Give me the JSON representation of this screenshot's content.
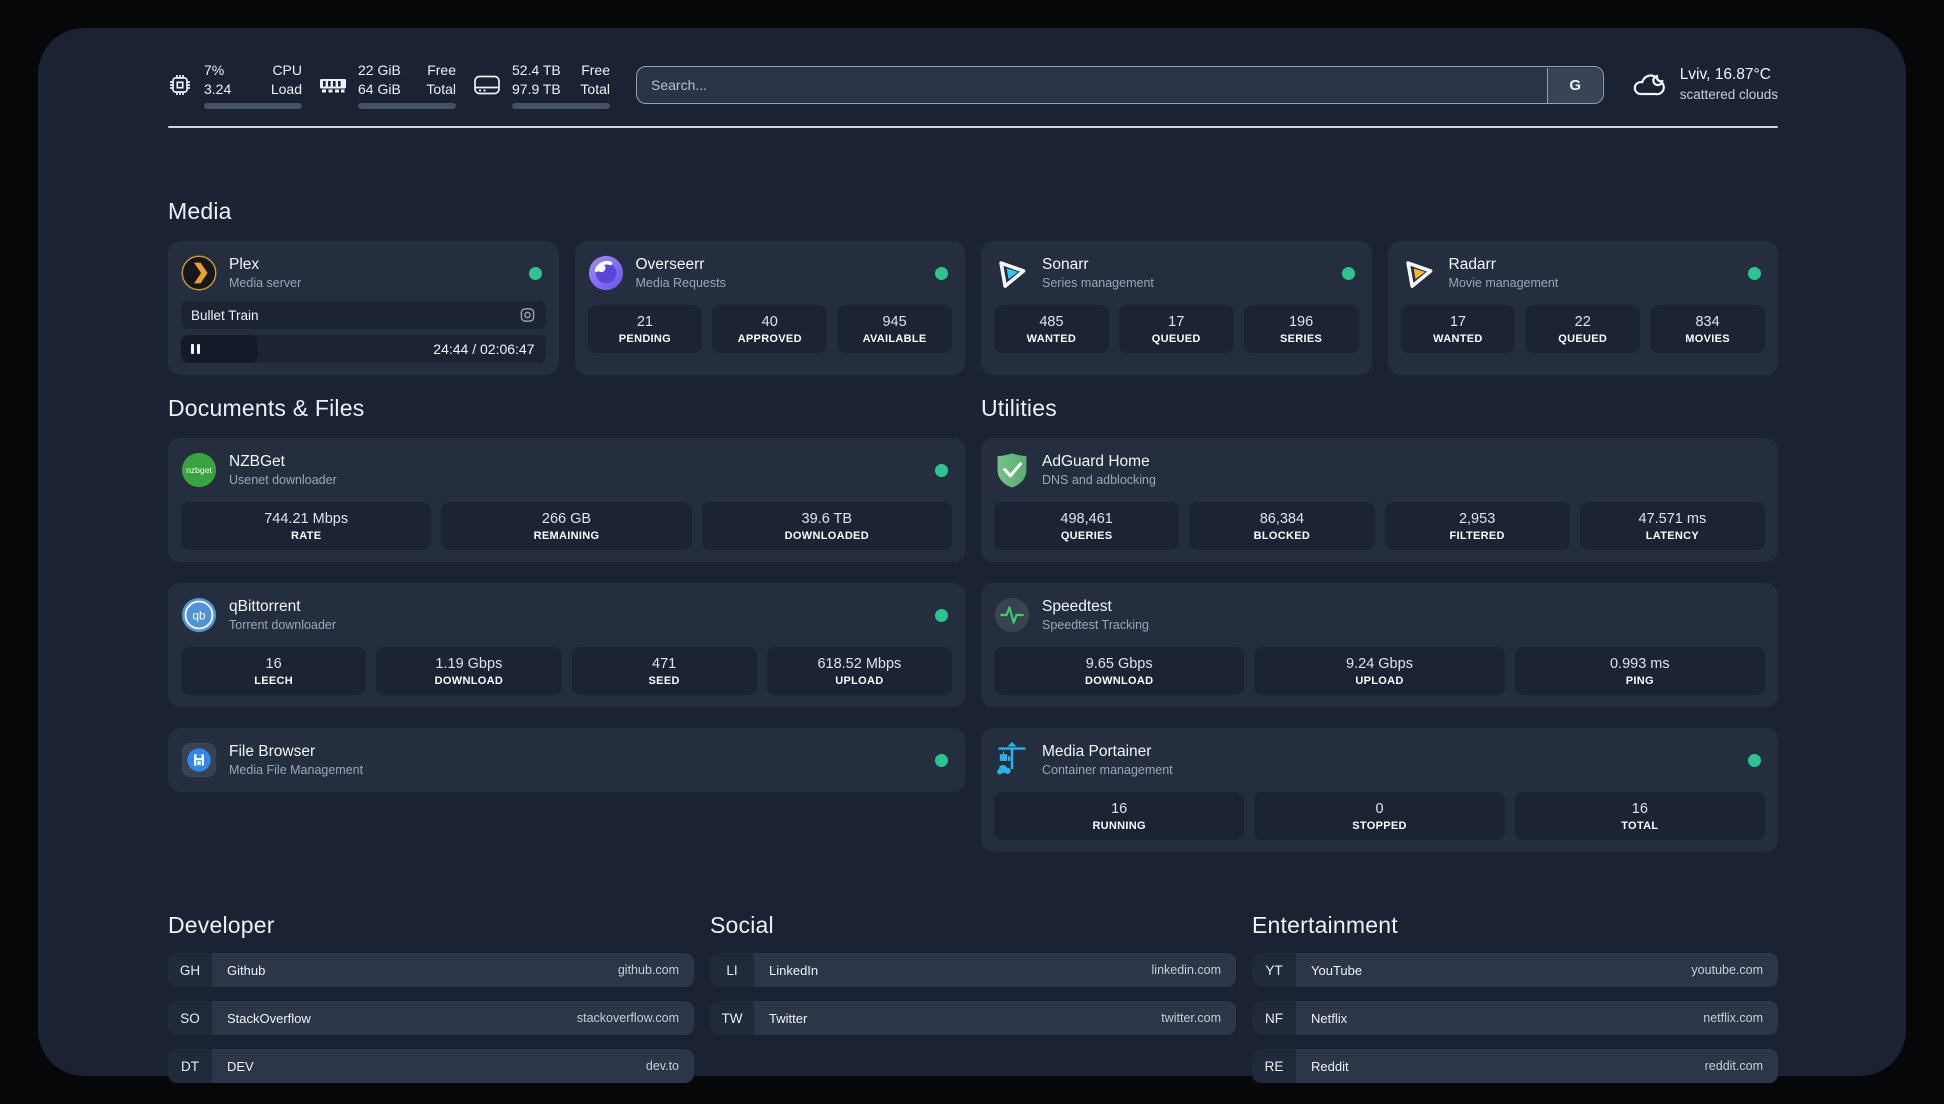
{
  "colors": {
    "frame_bg": "#1b2233",
    "card_bg": "#252e3f",
    "stat_box_bg": "#1c2434",
    "status_green": "#2bc58d",
    "plex_orange": "#e8a22c",
    "sonarr_blue": "#35c5f1",
    "radarr_yellow": "#f7b52c",
    "portainer_blue": "#29b2e8"
  },
  "topbar": {
    "cpu": {
      "icon": "cpu-icon",
      "value1": "7%",
      "value2": "3.24",
      "label1": "CPU",
      "label2": "Load",
      "progress_pct": 7
    },
    "memory": {
      "icon": "ram-icon",
      "value1": "22 GiB",
      "value2": "64 GiB",
      "label1": "Free",
      "label2": "Total",
      "progress_pct": 66
    },
    "disk": {
      "icon": "disk-icon",
      "value1": "52.4 TB",
      "value2": "97.9 TB",
      "label1": "Free",
      "label2": "Total",
      "progress_pct": 53
    },
    "search": {
      "placeholder": "Search...",
      "engine_button": "G"
    },
    "weather": {
      "icon": "cloud-icon",
      "location_temp": "Lviv, 16.87°C",
      "condition": "scattered clouds"
    }
  },
  "sections": {
    "media": "Media",
    "documents": "Documents & Files",
    "utilities": "Utilities",
    "developer": "Developer",
    "social": "Social",
    "entertainment": "Entertainment"
  },
  "apps": {
    "plex": {
      "name": "Plex",
      "desc": "Media server",
      "online": true,
      "now_playing": "Bullet Train",
      "time": "24:44 / 02:06:47",
      "progress_pct": 21
    },
    "overseerr": {
      "name": "Overseerr",
      "desc": "Media Requests",
      "online": true,
      "stats": [
        {
          "value": "21",
          "label": "PENDING"
        },
        {
          "value": "40",
          "label": "APPROVED"
        },
        {
          "value": "945",
          "label": "AVAILABLE"
        }
      ]
    },
    "sonarr": {
      "name": "Sonarr",
      "desc": "Series management",
      "online": true,
      "stats": [
        {
          "value": "485",
          "label": "WANTED"
        },
        {
          "value": "17",
          "label": "QUEUED"
        },
        {
          "value": "196",
          "label": "SERIES"
        }
      ]
    },
    "radarr": {
      "name": "Radarr",
      "desc": "Movie management",
      "online": true,
      "stats": [
        {
          "value": "17",
          "label": "WANTED"
        },
        {
          "value": "22",
          "label": "QUEUED"
        },
        {
          "value": "834",
          "label": "MOVIES"
        }
      ]
    },
    "nzbget": {
      "name": "NZBGet",
      "desc": "Usenet downloader",
      "online": true,
      "stats": [
        {
          "value": "744.21 Mbps",
          "label": "RATE"
        },
        {
          "value": "266 GB",
          "label": "REMAINING"
        },
        {
          "value": "39.6 TB",
          "label": "DOWNLOADED"
        }
      ]
    },
    "qbittorrent": {
      "name": "qBittorrent",
      "desc": "Torrent downloader",
      "online": true,
      "stats": [
        {
          "value": "16",
          "label": "LEECH"
        },
        {
          "value": "1.19 Gbps",
          "label": "DOWNLOAD"
        },
        {
          "value": "471",
          "label": "SEED"
        },
        {
          "value": "618.52 Mbps",
          "label": "UPLOAD"
        }
      ]
    },
    "filebrowser": {
      "name": "File Browser",
      "desc": "Media File Management",
      "online": true
    },
    "adguard": {
      "name": "AdGuard Home",
      "desc": "DNS and adblocking",
      "stats": [
        {
          "value": "498,461",
          "label": "QUERIES"
        },
        {
          "value": "86,384",
          "label": "BLOCKED"
        },
        {
          "value": "2,953",
          "label": "FILTERED"
        },
        {
          "value": "47.571 ms",
          "label": "LATENCY"
        }
      ]
    },
    "speedtest": {
      "name": "Speedtest",
      "desc": "Speedtest Tracking",
      "stats": [
        {
          "value": "9.65 Gbps",
          "label": "DOWNLOAD"
        },
        {
          "value": "9.24 Gbps",
          "label": "UPLOAD"
        },
        {
          "value": "0.993 ms",
          "label": "PING"
        }
      ]
    },
    "portainer": {
      "name": "Media Portainer",
      "desc": "Container management",
      "online": true,
      "stats": [
        {
          "value": "16",
          "label": "RUNNING"
        },
        {
          "value": "0",
          "label": "STOPPED"
        },
        {
          "value": "16",
          "label": "TOTAL"
        }
      ]
    }
  },
  "links": {
    "developer": [
      {
        "abbr": "GH",
        "name": "Github",
        "url": "github.com"
      },
      {
        "abbr": "SO",
        "name": "StackOverflow",
        "url": "stackoverflow.com"
      },
      {
        "abbr": "DT",
        "name": "DEV",
        "url": "dev.to"
      }
    ],
    "social": [
      {
        "abbr": "LI",
        "name": "LinkedIn",
        "url": "linkedin.com"
      },
      {
        "abbr": "TW",
        "name": "Twitter",
        "url": "twitter.com"
      }
    ],
    "entertainment": [
      {
        "abbr": "YT",
        "name": "YouTube",
        "url": "youtube.com"
      },
      {
        "abbr": "NF",
        "name": "Netflix",
        "url": "netflix.com"
      },
      {
        "abbr": "RE",
        "name": "Reddit",
        "url": "reddit.com"
      }
    ]
  }
}
